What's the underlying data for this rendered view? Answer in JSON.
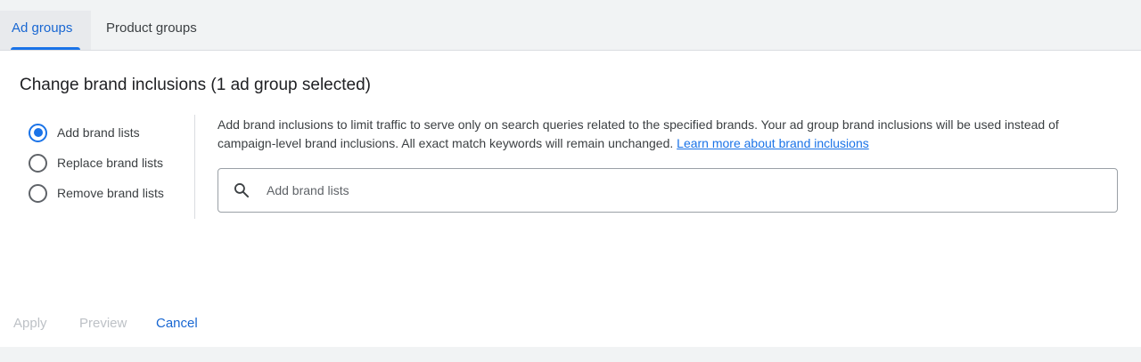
{
  "tabs": [
    {
      "label": "Ad groups",
      "active": true
    },
    {
      "label": "Product groups",
      "active": false
    }
  ],
  "panel": {
    "title": "Change brand inclusions (1 ad group selected)",
    "options": [
      {
        "label": "Add brand lists",
        "checked": true
      },
      {
        "label": "Replace brand lists",
        "checked": false
      },
      {
        "label": "Remove brand lists",
        "checked": false
      }
    ],
    "description": "Add brand inclusions to limit traffic to serve only on search queries related to the specified brands. Your ad group brand inclusions will be used instead of campaign-level brand inclusions. All exact match keywords will remain unchanged.",
    "learn_more": "Learn more about brand inclusions",
    "search_placeholder": "Add brand lists",
    "search_value": ""
  },
  "actions": {
    "apply": "Apply",
    "preview": "Preview",
    "cancel": "Cancel"
  },
  "colors": {
    "accent": "#1a73e8",
    "link": "#1a73e8",
    "disabled": "#bdc1c6"
  }
}
